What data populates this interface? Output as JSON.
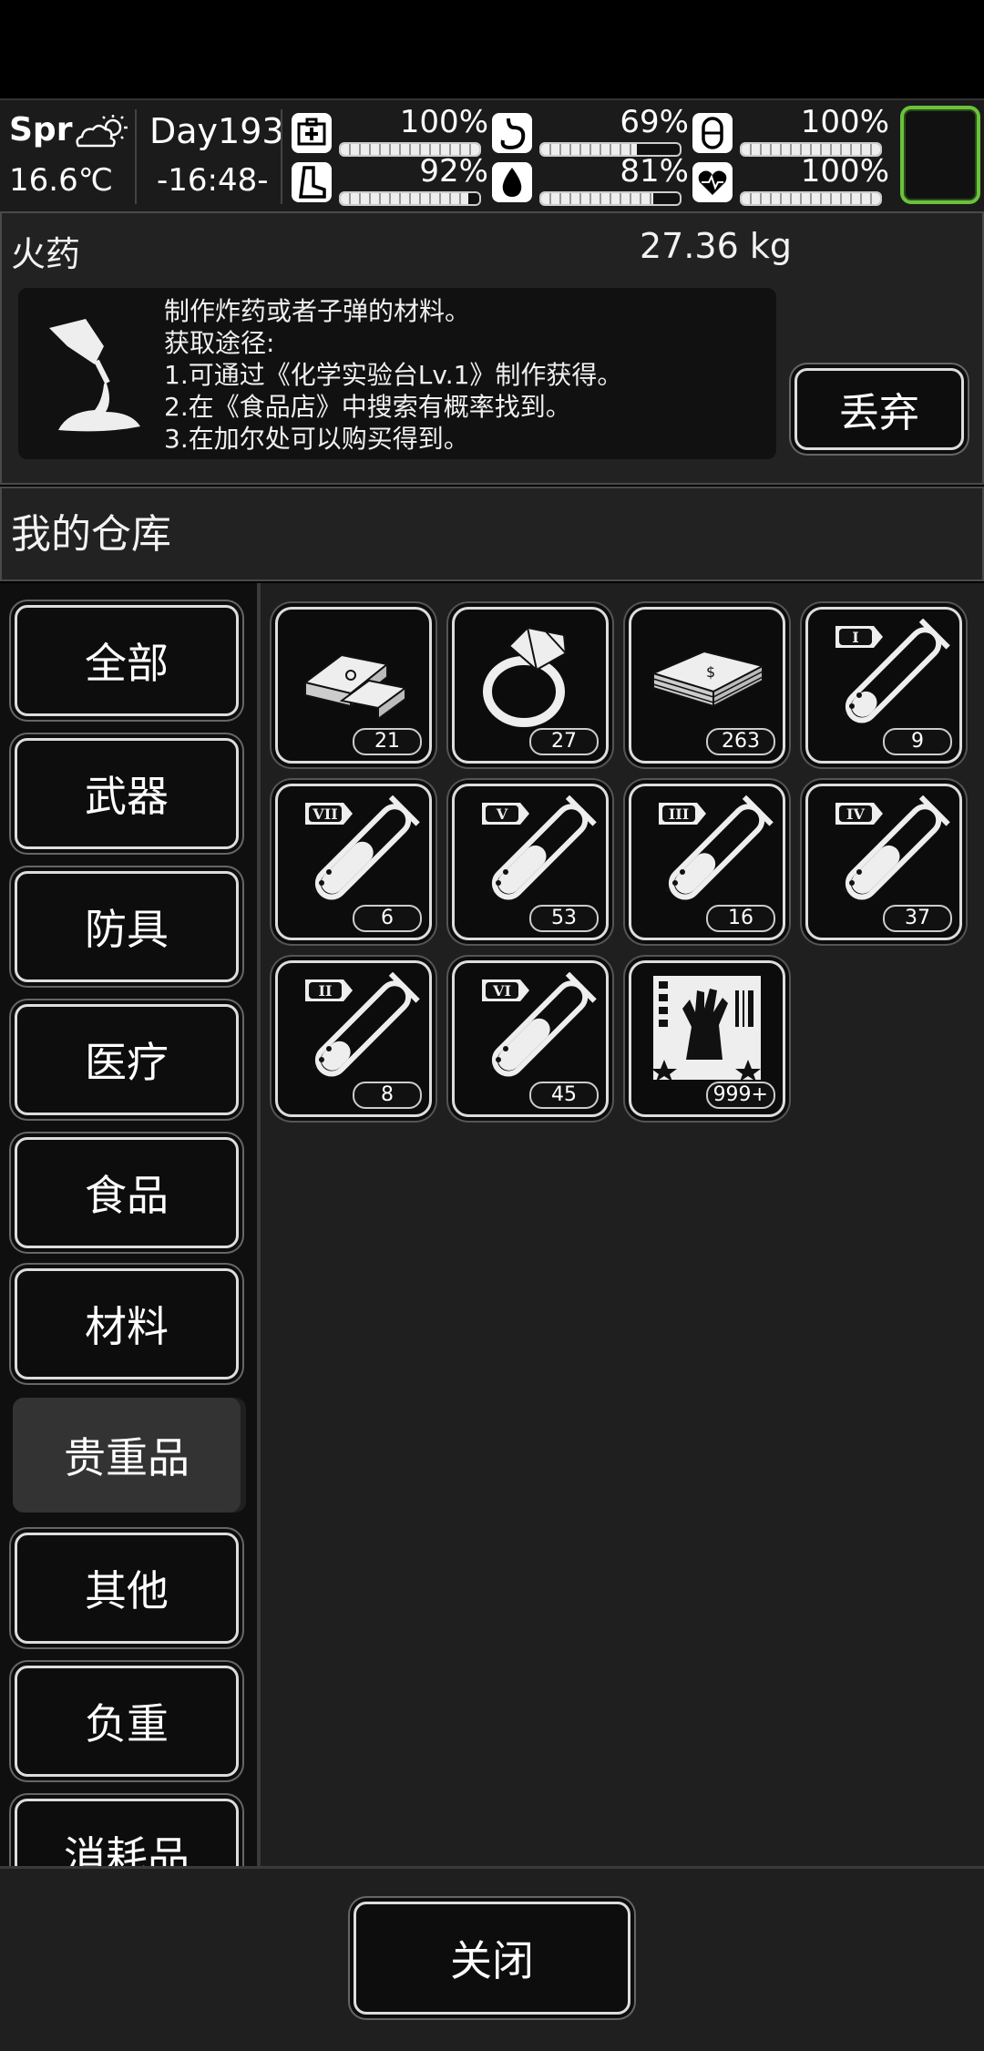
{
  "status": {
    "season": "Spr",
    "temperature": "16.6℃",
    "day": "Day193",
    "time": "-16:48-",
    "stats": [
      {
        "icon": "health-kit-icon",
        "percent": "100%",
        "value": 1.0
      },
      {
        "icon": "stomach-icon",
        "percent": "69%",
        "value": 0.69
      },
      {
        "icon": "pill-icon",
        "percent": "100%",
        "value": 1.0
      },
      {
        "icon": "boot-icon",
        "percent": "92%",
        "value": 0.92
      },
      {
        "icon": "water-drop-icon",
        "percent": "81%",
        "value": 0.81
      },
      {
        "icon": "heart-icon",
        "percent": "100%",
        "value": 1.0
      }
    ]
  },
  "detail": {
    "name": "火药",
    "weight": "27.36 kg",
    "description": [
      "制作炸药或者子弹的材料。",
      "获取途径:",
      "1.可通过《化学实验台Lv.1》制作获得。",
      "2.在《食品店》中搜索有概率找到。",
      "3.在加尔处可以购买得到。"
    ],
    "discard_label": "丢弃"
  },
  "section_title": "我的仓库",
  "categories": [
    "全部",
    "武器",
    "防具",
    "医疗",
    "食品",
    "材料",
    "贵重品",
    "其他",
    "负重",
    "消耗品"
  ],
  "active_category": "贵重品",
  "items": [
    {
      "icon": "gold-bars-icon",
      "count": "21"
    },
    {
      "icon": "diamond-ring-icon",
      "count": "27"
    },
    {
      "icon": "cash-stack-icon",
      "count": "263"
    },
    {
      "icon": "test-tube-i-icon",
      "count": "9",
      "numeral": "I"
    },
    {
      "icon": "test-tube-vii-icon",
      "count": "6",
      "numeral": "VII"
    },
    {
      "icon": "test-tube-v-icon",
      "count": "53",
      "numeral": "V"
    },
    {
      "icon": "test-tube-iii-icon",
      "count": "16",
      "numeral": "III"
    },
    {
      "icon": "test-tube-iv-icon",
      "count": "37",
      "numeral": "IV"
    },
    {
      "icon": "test-tube-ii-icon",
      "count": "8",
      "numeral": "II"
    },
    {
      "icon": "test-tube-vi-icon",
      "count": "45",
      "numeral": "VI"
    },
    {
      "icon": "zombie-card-icon",
      "count": "999+"
    }
  ],
  "close_label": "关闭"
}
